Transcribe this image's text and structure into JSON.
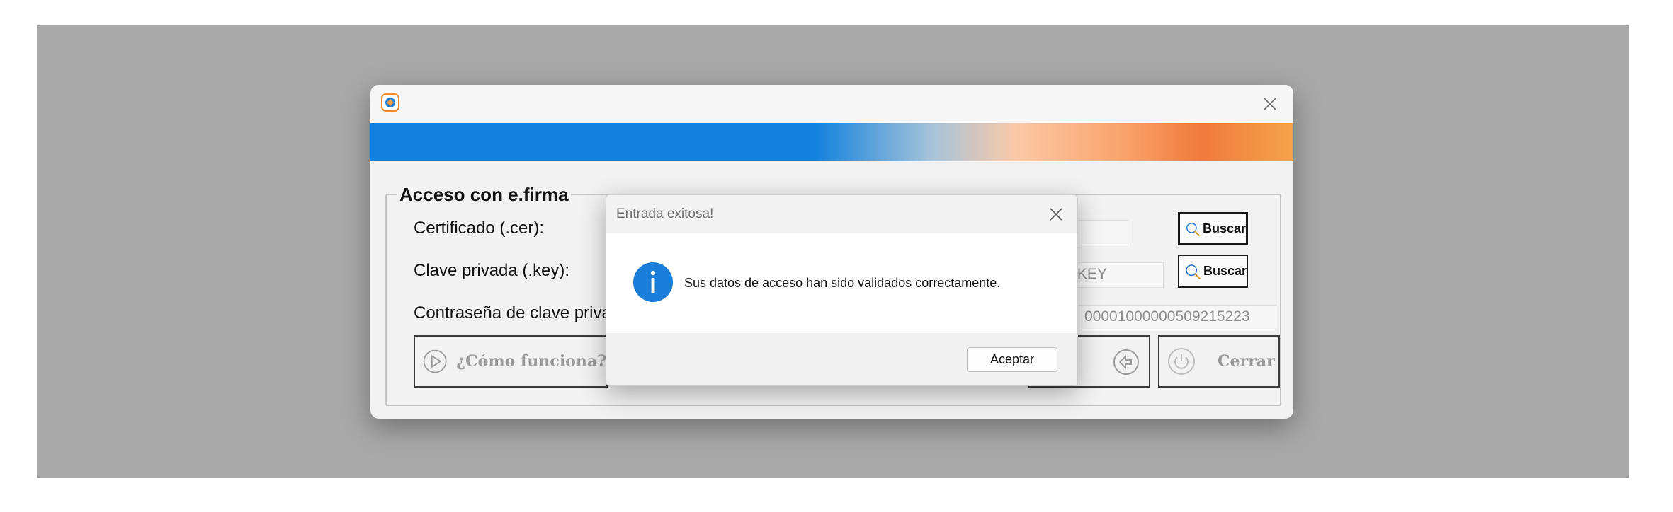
{
  "main_window": {
    "group_title": "Acceso con e.firma",
    "fields": {
      "certificate_label": "Certificado (.cer):",
      "private_key_label": "Clave privada (.key):",
      "private_key_value": ".KEY",
      "password_label": "Contraseña de clave priva",
      "password_value": "00001000000509215223"
    },
    "buttons": {
      "buscar_1": "Buscar",
      "buscar_2": "Buscar",
      "how_it_works": "¿Cómo funciona?",
      "close": "Cerrar"
    }
  },
  "dialog": {
    "title": "Entrada exitosa!",
    "message": "Sus datos de acceso han sido validados correctamente.",
    "accept_label": "Aceptar"
  },
  "colors": {
    "banner_blue": "#1181dd",
    "banner_orange": "#ef7a3d",
    "info_blue": "#1a7ed8"
  }
}
